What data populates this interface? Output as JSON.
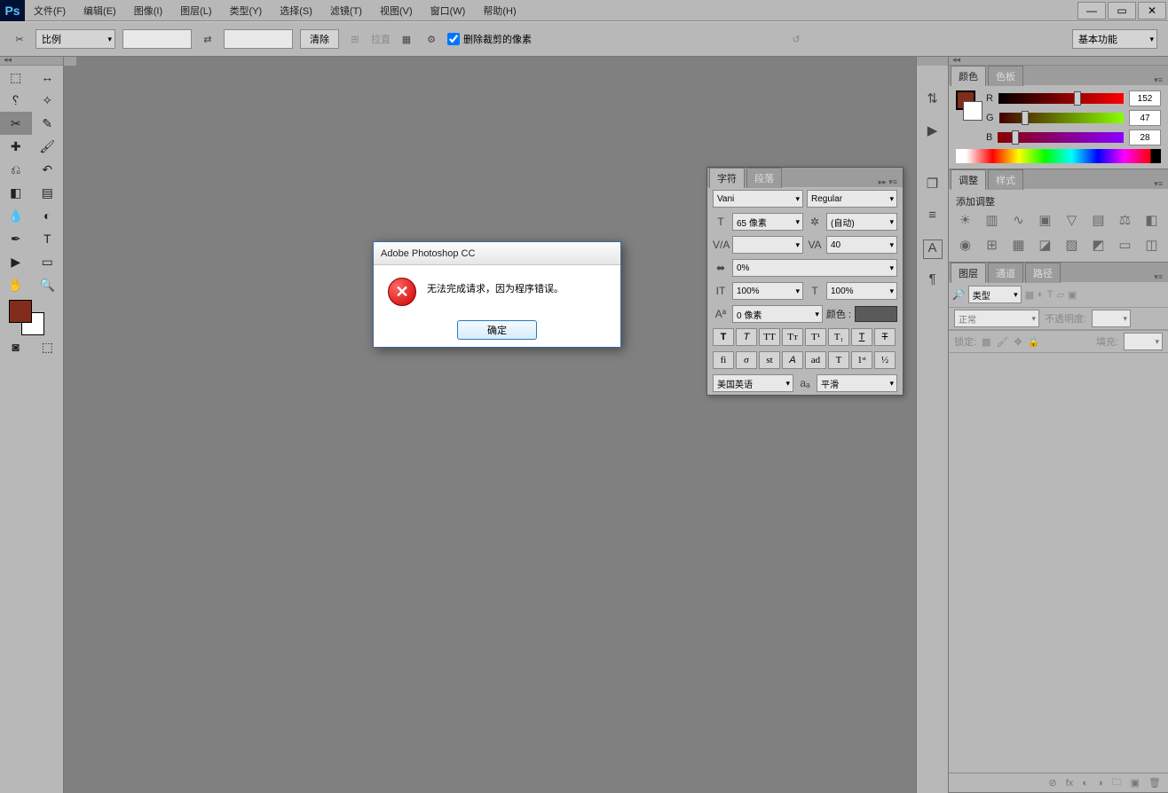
{
  "menu": {
    "items": [
      "文件(F)",
      "编辑(E)",
      "图像(I)",
      "图层(L)",
      "类型(Y)",
      "选择(S)",
      "滤镜(T)",
      "视图(V)",
      "窗口(W)",
      "帮助(H)"
    ]
  },
  "options": {
    "ratio_label": "比例",
    "clear": "清除",
    "straighten": "拉直",
    "delete_cropped": "删除裁剪的像素",
    "essentials": "基本功能"
  },
  "color_panel": {
    "tab_color": "颜色",
    "tab_swatch": "色板",
    "r_label": "R",
    "r_val": "152",
    "g_label": "G",
    "g_val": "47",
    "b_label": "B",
    "b_val": "28"
  },
  "adjust_panel": {
    "tab_adjust": "调整",
    "tab_style": "样式",
    "add_adjust": "添加调整"
  },
  "layers_panel": {
    "tab_layers": "图层",
    "tab_channels": "通道",
    "tab_paths": "路径",
    "kind": "类型",
    "blend": "正常",
    "opacity_label": "不透明度:",
    "opacity_val": "",
    "lock_label": "锁定:",
    "fill_label": "填充:",
    "fill_val": ""
  },
  "char_panel": {
    "tab_char": "字符",
    "tab_para": "段落",
    "font": "Vani",
    "style": "Regular",
    "size": "65 像素",
    "leading": "(自动)",
    "tracking": "40",
    "va": "",
    "color_label": "颜色 :",
    "scaley": "100%",
    "scalex": "100%",
    "baseline": "0 像素",
    "scale0": "0%",
    "lang": "美国英语",
    "aa": "平滑"
  },
  "dialog": {
    "title": "Adobe Photoshop CC",
    "message": "无法完成请求，因为程序错误。",
    "ok": "确定"
  },
  "iconstrip": {
    "a": "⇅",
    "b": "▶",
    "c": "❐",
    "d": "≡",
    "e": "A",
    "f": "¶"
  }
}
